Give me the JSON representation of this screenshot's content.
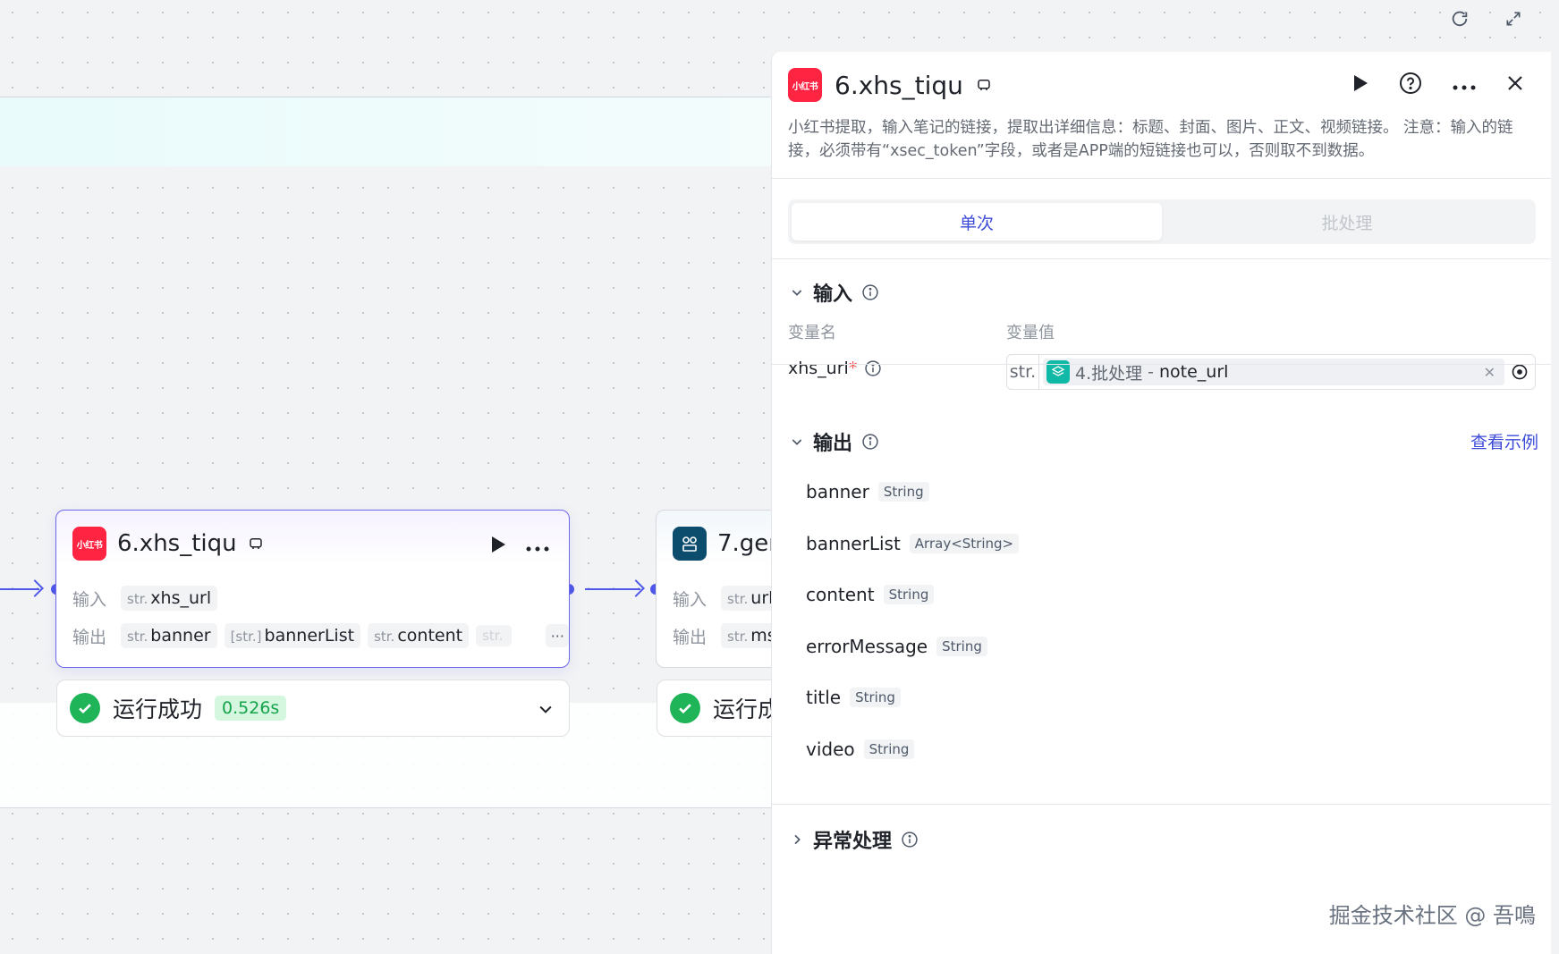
{
  "canvas": {
    "toolbar": {
      "refresh_icon": "refresh-icon",
      "expand_icon": "expand-icon"
    },
    "node6": {
      "logo_text": "小红书",
      "title": "6.xhs_tiqu",
      "input_label": "输入",
      "output_label": "输出",
      "inputs": [
        {
          "type": "str.",
          "name": "xhs_url"
        }
      ],
      "outputs": [
        {
          "type": "str.",
          "name": "banner"
        },
        {
          "type": "[str.]",
          "name": "bannerList"
        },
        {
          "type": "str.",
          "name": "content"
        },
        {
          "type": "str.",
          "name": ""
        }
      ],
      "status": "运行成功",
      "duration": "0.526s"
    },
    "node7": {
      "title": "7.gen",
      "input_label": "输入",
      "output_label": "输出",
      "input_type": "str.",
      "input_name": "url",
      "output_type": "str.",
      "output_name": "ms",
      "status": "运行成"
    }
  },
  "panel": {
    "logo_text": "小红书",
    "title": "6.xhs_tiqu",
    "description": "小红书提取，输入笔记的链接，提取出详细信息：标题、封面、图片、正文、视频链接。 注意：输入的链接，必须带有“xsec_token”字段，或者是APP端的短链接也可以，否则取不到数据。",
    "tabs": [
      {
        "label": "单次",
        "active": true
      },
      {
        "label": "批处理",
        "active": false
      }
    ],
    "input_section": {
      "title": "输入",
      "col_name": "变量名",
      "col_value": "变量值",
      "var_name": "xhs_url",
      "required_mark": "*",
      "value_type": "str.",
      "value_source": "4.批处理",
      "value_separator": "-",
      "value_field": "note_url"
    },
    "output_section": {
      "title": "输出",
      "example_link": "查看示例",
      "fields": [
        {
          "name": "banner",
          "type": "String"
        },
        {
          "name": "bannerList",
          "type": "Array<String>"
        },
        {
          "name": "content",
          "type": "String"
        },
        {
          "name": "errorMessage",
          "type": "String"
        },
        {
          "name": "title",
          "type": "String"
        },
        {
          "name": "video",
          "type": "String"
        }
      ]
    },
    "error_section": {
      "title": "异常处理"
    }
  },
  "watermark": "掘金技术社区 @ 吾鳴",
  "colors": {
    "accent": "#4f58e8",
    "brand_red": "#ff2442",
    "success": "#1fb457",
    "link": "#3c4bd8"
  }
}
